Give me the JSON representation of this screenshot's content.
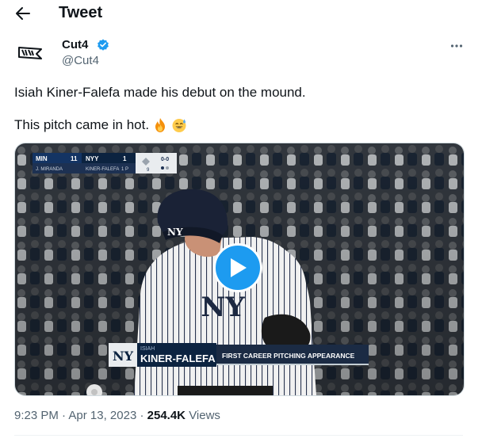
{
  "header": {
    "title": "Tweet"
  },
  "author": {
    "name": "Cut4",
    "handle": "@Cut4"
  },
  "tweet": {
    "line1": "Isiah Kiner-Falefa made his debut on the mound.",
    "line2": "This pitch came in hot."
  },
  "video": {
    "scorebug": {
      "away_team": "MIN",
      "away_score": "11",
      "home_team": "NYY",
      "home_score": "1",
      "away_player": "J. MIRANDA",
      "home_player": "KINER-FALEFA",
      "pitch_count": "1 P",
      "inning": "9",
      "count": "0-0"
    },
    "lower_third": {
      "first_name": "ISIAH",
      "last_name": "KINER-FALEFA",
      "caption": "FIRST CAREER PITCHING APPEARANCE"
    }
  },
  "meta": {
    "time": "9:23 PM",
    "date": "Apr 13, 2023",
    "views": "254.4K",
    "views_label": "Views"
  },
  "colors": {
    "accent": "#1d9bf0",
    "muted": "#536471",
    "text": "#0f1419"
  }
}
